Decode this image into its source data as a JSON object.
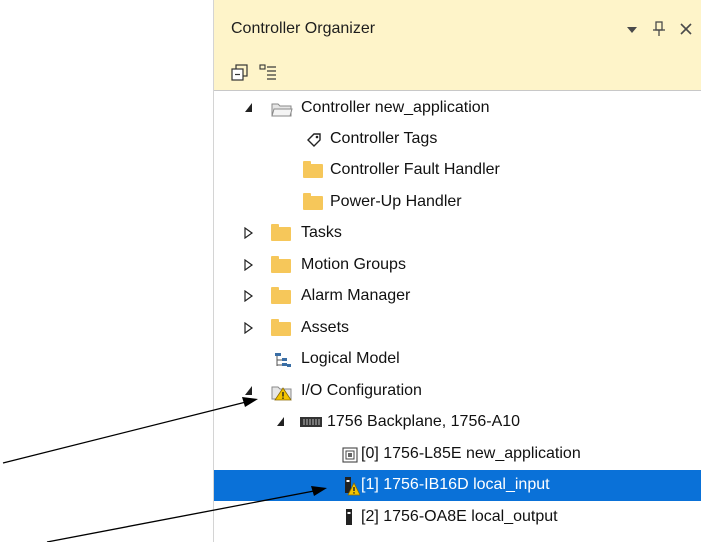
{
  "panel": {
    "title": "Controller Organizer",
    "controls": [
      "▾",
      "ᴾ",
      "✕"
    ]
  },
  "tree": [
    {
      "label": "Controller new_application"
    },
    {
      "label": "Controller Tags"
    },
    {
      "label": "Controller Fault Handler"
    },
    {
      "label": "Power-Up Handler"
    },
    {
      "label": "Tasks"
    },
    {
      "label": "Motion Groups"
    },
    {
      "label": "Alarm Manager"
    },
    {
      "label": "Assets"
    },
    {
      "label": "Logical Model"
    },
    {
      "label": "I/O Configuration"
    },
    {
      "label": "1756 Backplane, 1756-A10"
    },
    {
      "label": "[0] 1756-L85E new_application"
    },
    {
      "label": "[1] 1756-IB16D local_input",
      "selected": true
    },
    {
      "label": "[2] 1756-OA8E local_output"
    }
  ],
  "colors": {
    "titlebar": "#fef4c9",
    "selection": "#0a71d8",
    "folder": "#f6c75a",
    "warning": "#f4c400"
  }
}
